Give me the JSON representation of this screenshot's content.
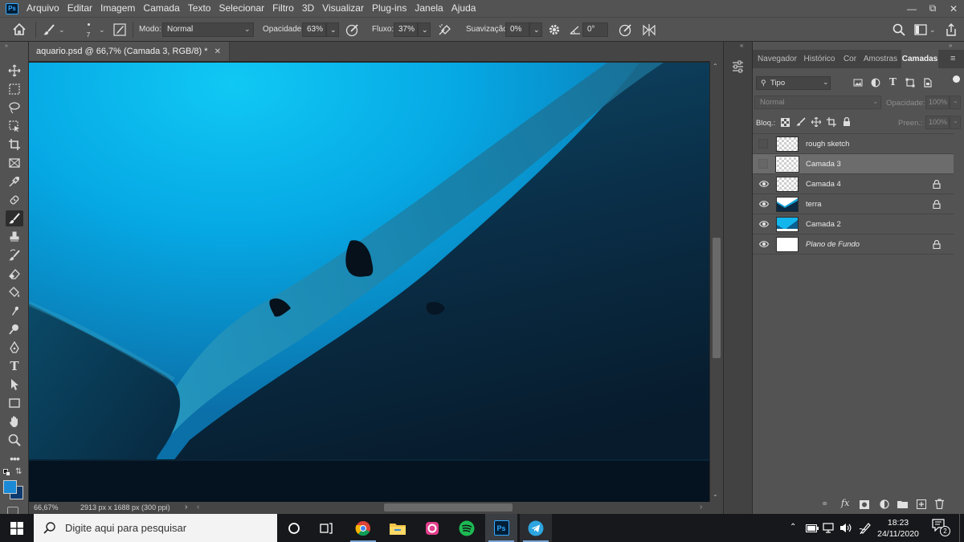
{
  "menubar": {
    "logo": "Ps",
    "items": [
      "Arquivo",
      "Editar",
      "Imagem",
      "Camada",
      "Texto",
      "Selecionar",
      "Filtro",
      "3D",
      "Visualizar",
      "Plug-ins",
      "Janela",
      "Ajuda"
    ]
  },
  "options": {
    "brush_size": "7",
    "mode_label": "Modo:",
    "mode_value": "Normal",
    "opacity_label": "Opacidade:",
    "opacity_value": "63%",
    "flow_label": "Fluxo:",
    "flow_value": "37%",
    "smoothing_label": "Suavização:",
    "smoothing_value": "0%",
    "angle_value": "0°"
  },
  "document": {
    "tab_title": "aquario.psd @ 66,7% (Camada 3, RGB/8) *",
    "zoom": "66,67%",
    "doc_info": "2913 px x 1688 px (300 ppi)"
  },
  "panel": {
    "tabs": [
      "Navegador",
      "Histórico",
      "Cor",
      "Amostras",
      "Camadas"
    ],
    "active_tab": "Camadas",
    "filter_value": "Tipo",
    "blend_mode": "Normal",
    "opacity_label": "Opacidade:",
    "opacity_value": "100%",
    "lock_label": "Bloq.:",
    "fill_label": "Preen.:",
    "fill_value": "100%",
    "layers": [
      {
        "name": "rough sketch",
        "visible": false,
        "locked": false,
        "selected": false,
        "italic": false
      },
      {
        "name": "Camada 3",
        "visible": false,
        "locked": false,
        "selected": true,
        "italic": false
      },
      {
        "name": "Camada 4",
        "visible": true,
        "locked": true,
        "selected": false,
        "italic": false
      },
      {
        "name": "terra",
        "visible": true,
        "locked": true,
        "selected": false,
        "italic": false
      },
      {
        "name": "Camada 2",
        "visible": true,
        "locked": false,
        "selected": false,
        "italic": false
      },
      {
        "name": "Plano de Fundo",
        "visible": true,
        "locked": true,
        "selected": false,
        "italic": true
      }
    ]
  },
  "taskbar": {
    "search_placeholder": "Digite aqui para pesquisar",
    "time": "18:23",
    "date": "24/11/2020",
    "notifications": "2"
  },
  "colors": {
    "foreground": "#1b8ad6",
    "background": "#0c3a6e",
    "accent": "#31a8ff"
  }
}
